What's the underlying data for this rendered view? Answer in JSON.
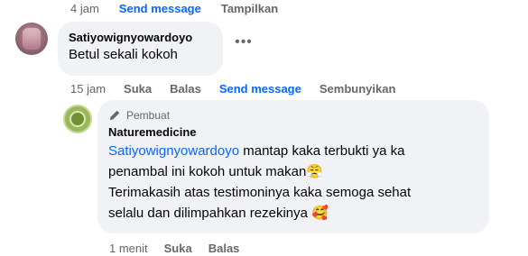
{
  "top_actions": {
    "time": "4 jam",
    "send_message": "Send message",
    "show": "Tampilkan"
  },
  "comment": {
    "author": "Satiyowignyowardoyo",
    "text": "Betul sekali kokoh",
    "more_icon": "ellipsis-icon",
    "actions": {
      "time": "15 jam",
      "like": "Suka",
      "reply": "Balas",
      "send_message": "Send message",
      "hide": "Sembunyikan"
    }
  },
  "reply": {
    "badge": "Pembuat",
    "badge_icon": "pencil-icon",
    "author": "Naturemedicine",
    "mention": "Satiyowignyowardoyo",
    "line1_rest": " mantap kaka terbukti ya ka",
    "line2": "penambal ini kokoh untuk makan",
    "line2_emoji": "😤",
    "line3": "Terimakasih atas testimoninya kaka semoga sehat",
    "line4": "selalu dan dilimpahkan rezekinya",
    "line4_emoji": "🥰",
    "actions": {
      "time": "1 menit",
      "like": "Suka",
      "reply": "Balas"
    }
  },
  "colors": {
    "accent": "#0866ff",
    "muted": "#65676b",
    "bubble": "#f0f2f5"
  }
}
